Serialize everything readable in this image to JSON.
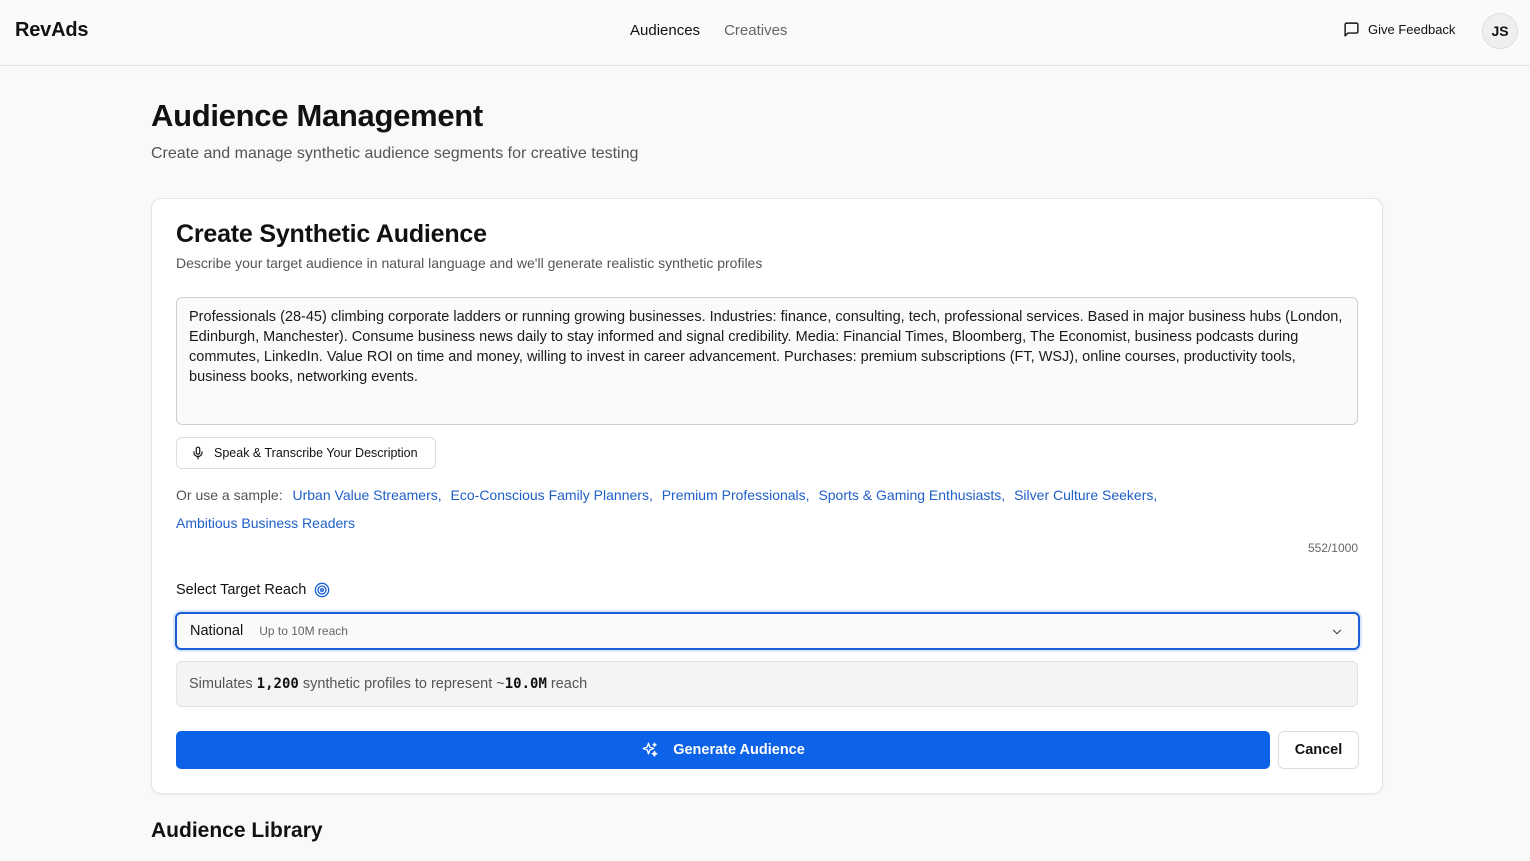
{
  "header": {
    "brand": "RevAds",
    "nav": [
      {
        "label": "Audiences",
        "active": true
      },
      {
        "label": "Creatives",
        "active": false
      }
    ],
    "feedback_label": "Give Feedback",
    "avatar_initials": "JS"
  },
  "page": {
    "title": "Audience Management",
    "subtitle": "Create and manage synthetic audience segments for creative testing"
  },
  "create_card": {
    "title": "Create Synthetic Audience",
    "subtitle": "Describe your target audience in natural language and we'll generate realistic synthetic profiles",
    "description_value": "Professionals (28-45) climbing corporate ladders or running growing businesses. Industries: finance, consulting, tech, professional services. Based in major business hubs (London, Edinburgh, Manchester). Consume business news daily to stay informed and signal credibility. Media: Financial Times, Bloomberg, The Economist, business podcasts during commutes, LinkedIn. Value ROI on time and money, willing to invest in career advancement. Purchases: premium subscriptions (FT, WSJ), online courses, productivity tools, business books, networking events.",
    "speak_button": "Speak & Transcribe Your Description",
    "samples_label": "Or use a sample:",
    "samples": [
      "Urban Value Streamers,",
      "Eco-Conscious Family Planners,",
      "Premium Professionals,",
      "Sports & Gaming Enthusiasts,",
      "Silver Culture Seekers,",
      "Ambitious Business Readers"
    ],
    "char_count": "552/1000",
    "reach_label": "Select Target Reach",
    "reach_selected": "National",
    "reach_hint": "Up to 10M reach",
    "sim_prefix": "Simulates",
    "sim_profiles": "1,200",
    "sim_middle": "synthetic profiles to represent ~",
    "sim_reach": "10.0M",
    "sim_suffix": "reach",
    "generate_button": "Generate Audience",
    "cancel_button": "Cancel"
  },
  "library": {
    "title": "Audience Library"
  },
  "colors": {
    "accent": "#0c63e7",
    "link": "#1f5fc9"
  }
}
